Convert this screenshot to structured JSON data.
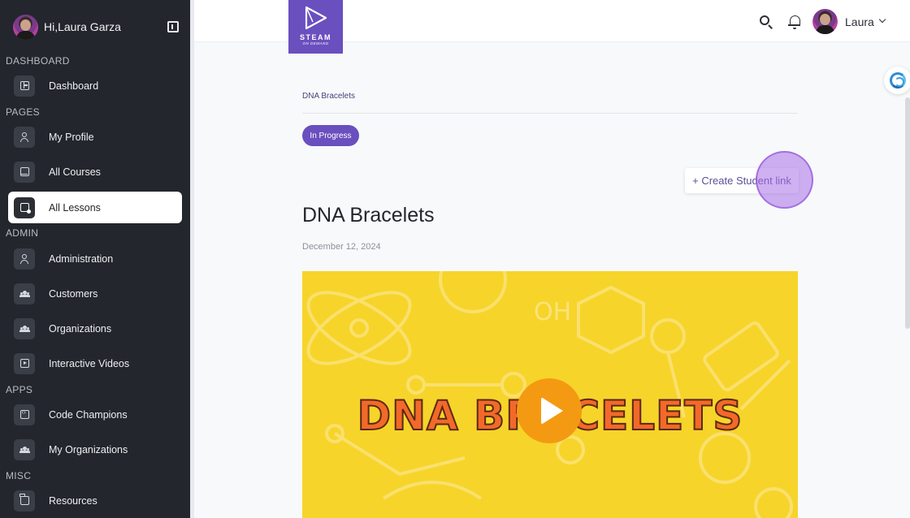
{
  "sidebar": {
    "greeting": "Hi,Laura Garza",
    "sections": {
      "dashboard": "DASHBOARD",
      "pages": "PAGES",
      "admin": "ADMIN",
      "apps": "APPS",
      "misc": "MISC"
    },
    "items": {
      "dashboard": "Dashboard",
      "my_profile": "My Profile",
      "all_courses": "All Courses",
      "all_lessons": "All Lessons",
      "administration": "Administration",
      "customers": "Customers",
      "organizations": "Organizations",
      "interactive_videos": "Interactive Videos",
      "code_champions": "Code Champions",
      "my_organizations": "My Organizations",
      "resources": "Resources"
    },
    "active_item": "All Lessons"
  },
  "header": {
    "logo_text": "STEAM",
    "logo_subtext": "ON DEMAND",
    "user_name": "Laura"
  },
  "lesson": {
    "breadcrumb": "DNA Bracelets",
    "status": "In Progress",
    "create_link_label": "+ Create Student link",
    "title": "DNA Bracelets",
    "date": "December 12, 2024",
    "video_title": "DNA BRACELETS"
  },
  "colors": {
    "sidebar_bg": "#23262c",
    "accent": "#6a4fbf",
    "video_bg": "#f7d42a",
    "play_button": "#f49a12"
  }
}
